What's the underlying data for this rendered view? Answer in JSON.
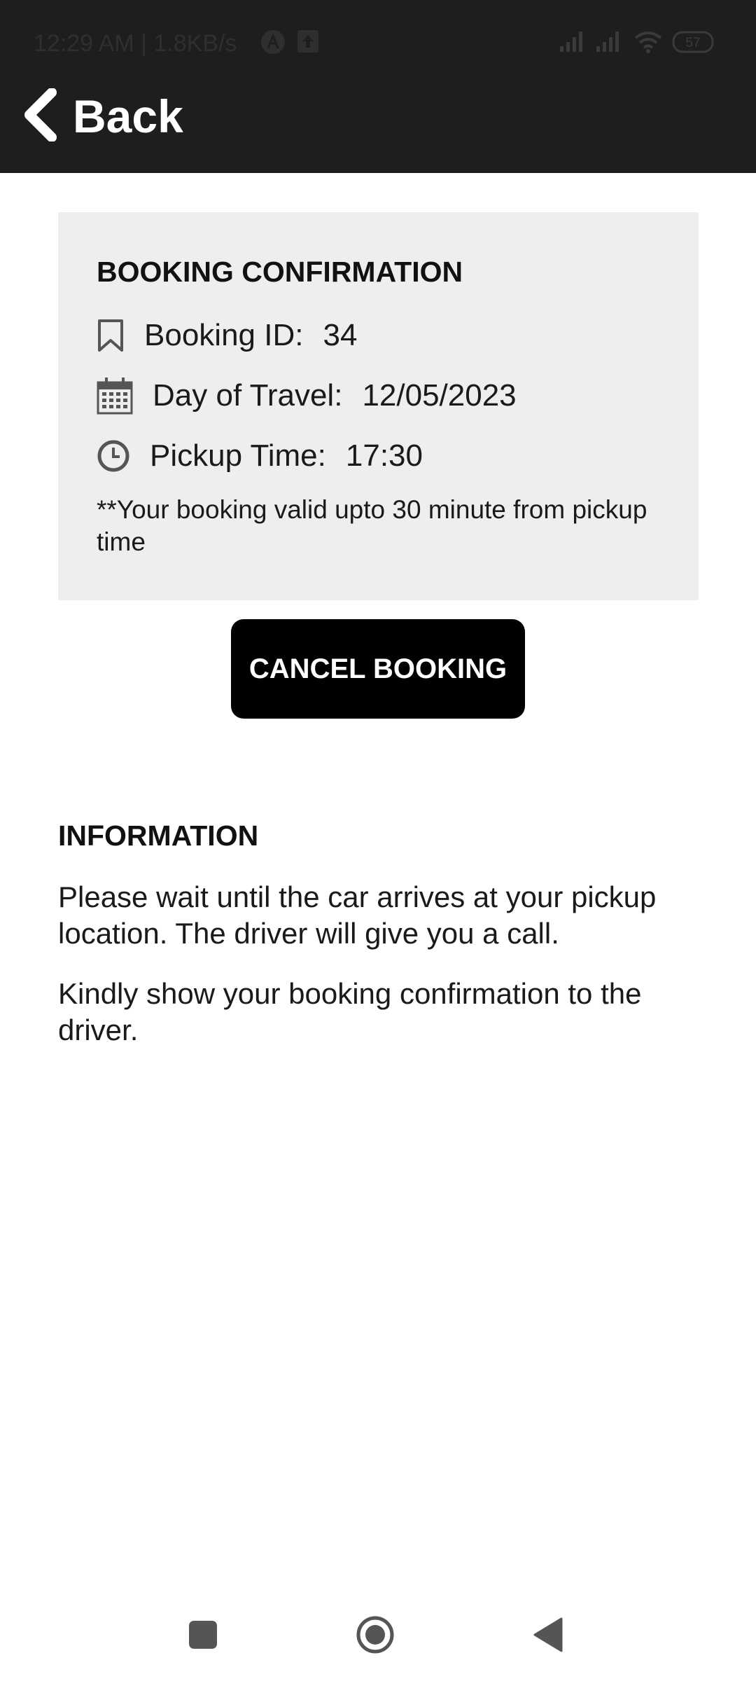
{
  "status_bar": {
    "time_speed": "12:29 AM | 1.8KB/s",
    "battery": "57",
    "icons": [
      "app-a-icon",
      "upload-icon",
      "signal-icon",
      "signal-icon",
      "wifi-icon",
      "battery-icon"
    ]
  },
  "header": {
    "back_label": "Back",
    "back_icon": "chevron-left-icon"
  },
  "booking": {
    "title": "BOOKING CONFIRMATION",
    "id_label": "Booking ID:",
    "id_value": "34",
    "day_label": "Day of Travel:",
    "day_value": "12/05/2023",
    "time_label": "Pickup Time:",
    "time_value": "17:30",
    "note": "**Your booking valid upto 30 minute from pickup time",
    "icons": [
      "bookmark-icon",
      "calendar-icon",
      "clock-icon"
    ]
  },
  "actions": {
    "cancel_label": "CANCEL BOOKING"
  },
  "information": {
    "title": "INFORMATION",
    "paragraph_1": "Please wait until the car arrives at your pickup location. The driver will give you a call.",
    "paragraph_2": "Kindly show your booking confirmation to the driver."
  },
  "nav_bar": {
    "buttons": [
      "recent-apps-icon",
      "home-icon",
      "back-triangle-icon"
    ]
  },
  "colors": {
    "header_bg": "#1e1e1e",
    "card_bg": "#eeeeee",
    "button_bg": "#000000"
  }
}
